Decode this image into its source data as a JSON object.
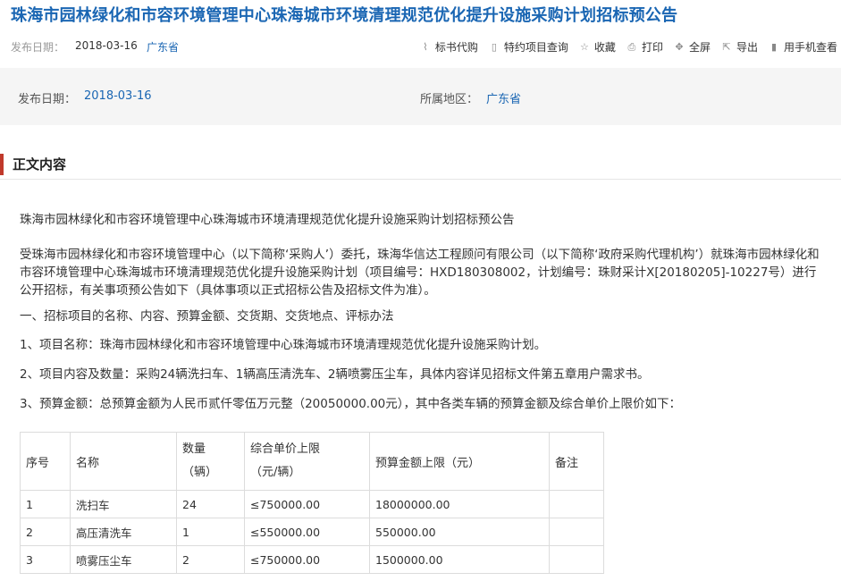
{
  "page_title": "珠海市园林绿化和市容环境管理中心珠海城市环境清理规范优化提升设施采购计划招标预公告",
  "meta": {
    "date_label": "发布日期：",
    "date": "2018-03-16",
    "region": "广东省"
  },
  "toolbar": [
    {
      "icon": "scissors-icon",
      "glyph": "⌇",
      "label": "标书代购"
    },
    {
      "icon": "document-icon",
      "glyph": "▯",
      "label": "特约项目查询"
    },
    {
      "icon": "star-icon",
      "glyph": "☆",
      "label": "收藏"
    },
    {
      "icon": "print-icon",
      "glyph": "⎙",
      "label": "打印"
    },
    {
      "icon": "fullscreen-icon",
      "glyph": "✥",
      "label": "全屏"
    },
    {
      "icon": "export-icon",
      "glyph": "⇱",
      "label": "导出"
    },
    {
      "icon": "mobile-icon",
      "glyph": "▮",
      "label": "用手机查看"
    }
  ],
  "info": {
    "date_label": "发布日期：",
    "date": "2018-03-16",
    "region_label": "所属地区：",
    "region": "广东省"
  },
  "section_title": "正文内容",
  "content": {
    "p1": "珠海市园林绿化和市容环境管理中心珠海城市环境清理规范优化提升设施采购计划招标预公告",
    "p2": "受珠海市园林绿化和市容环境管理中心（以下简称‘采购人’）委托，珠海华信达工程顾问有限公司（以下简称‘政府采购代理机构’）就珠海市园林绿化和市容环境管理中心珠海城市环境清理规范优化提升设施采购计划（项目编号：HXD180308002，计划编号：珠财采计X[20180205]-10227号）进行公开招标，有关事项预公告如下（具体事项以正式招标公告及招标文件为准）。",
    "p3": "一、招标项目的名称、内容、预算金额、交货期、交货地点、评标办法",
    "p4": "1、项目名称：珠海市园林绿化和市容环境管理中心珠海城市环境清理规范优化提升设施采购计划。",
    "p5": "2、项目内容及数量：采购24辆洗扫车、1辆高压清洗车、2辆喷雾压尘车，具体内容详见招标文件第五章用户需求书。",
    "p6": "3、预算金额：总预算金额为人民币贰仟零伍万元整（20050000.00元），其中各类车辆的预算金额及综合单价上限价如下："
  },
  "table": {
    "headers": {
      "seq": "序号",
      "name": "名称",
      "qty_1": "数量",
      "qty_2": "（辆）",
      "unit_1": "综合单价上限",
      "unit_2": "（元/辆）",
      "budget": "预算金额上限（元）",
      "note": "备注"
    },
    "rows": [
      {
        "seq": "1",
        "name": "洗扫车",
        "qty": "24",
        "unit": "≤750000.00",
        "budget": "18000000.00",
        "note": ""
      },
      {
        "seq": "2",
        "name": "高压清洗车",
        "qty": "1",
        "unit": "≤550000.00",
        "budget": "550000.00",
        "note": ""
      },
      {
        "seq": "3",
        "name": "喷雾压尘车",
        "qty": "2",
        "unit": "≤750000.00",
        "budget": "1500000.00",
        "note": ""
      }
    ]
  }
}
